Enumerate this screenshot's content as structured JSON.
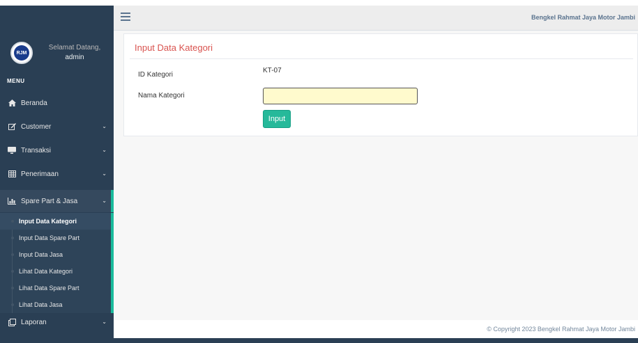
{
  "app": {
    "title": "Bengkel Rahmat Jaya Motor Jambi"
  },
  "profile": {
    "avatar_text": "RJM",
    "welcome": "Selamat Datang,",
    "name": "admin"
  },
  "sidebar": {
    "menu_title": "MENU",
    "items": [
      {
        "label": "Beranda",
        "icon": "home-icon",
        "chevron": ""
      },
      {
        "label": "Customer",
        "icon": "edit-icon",
        "chevron": "⌄"
      },
      {
        "label": "Transaksi",
        "icon": "desktop-icon",
        "chevron": "⌄"
      },
      {
        "label": "Penerimaan",
        "icon": "table-icon",
        "chevron": "⌄"
      },
      {
        "label": "Spare Part & Jasa",
        "icon": "bar-chart-icon",
        "chevron": "⌄"
      },
      {
        "label": "Laporan",
        "icon": "clone-icon",
        "chevron": "⌄"
      }
    ],
    "submenu": [
      {
        "label": "Input Data Kategori"
      },
      {
        "label": "Input Data Spare Part"
      },
      {
        "label": "Input Data Jasa"
      },
      {
        "label": "Lihat Data Kategori"
      },
      {
        "label": "Lihat Data Spare Part"
      },
      {
        "label": "Lihat Data Jasa"
      }
    ]
  },
  "form": {
    "title": "Input Data Kategori",
    "id_label": "ID Kategori",
    "id_value": "KT-07",
    "name_label": "Nama Kategori",
    "name_value": "",
    "submit_label": "Input"
  },
  "footer": {
    "text": "© Copyright 2023 Bengkel Rahmat Jaya Motor Jambi"
  },
  "colors": {
    "sidebar": "#2a3f54",
    "accent": "#1abb9c",
    "button": "#26b99a",
    "title": "#d9534f",
    "input_bg": "#fffacd"
  }
}
